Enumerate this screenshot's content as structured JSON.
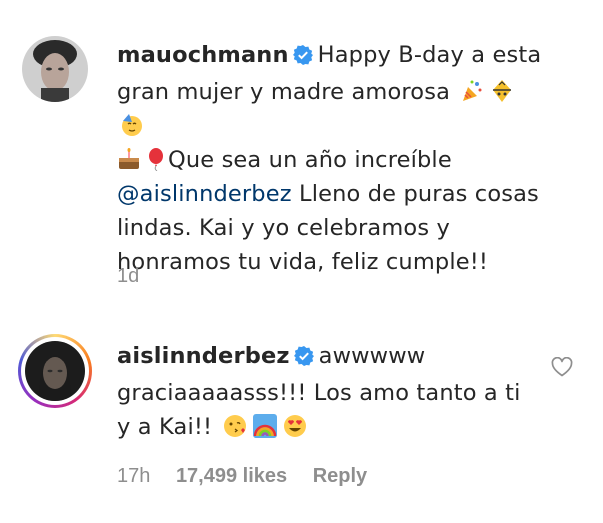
{
  "comments": [
    {
      "username": "mauochmann",
      "segments": {
        "part1": "Happy B-day a esta gran mujer y madre amorosa",
        "part2": "Que sea un año increíble",
        "mention": "@aislinnderbez",
        "part3": "Lleno de puras cosas lindas. Kai y yo celebramos y honramos tu vida, feliz cumple!!"
      },
      "emojis": [
        "party-popper-icon",
        "lantern-face-icon",
        "partying-face-icon",
        "birthday-cake-icon",
        "balloon-icon"
      ],
      "time": "1d"
    },
    {
      "username": "aislinnderbez",
      "text": "awwwww graciaaaaasss!!! Los amo tanto a ti y a Kai!!",
      "emojis": [
        "kissing-face-icon",
        "rainbow-icon",
        "heart-eyes-face-icon"
      ],
      "time": "17h",
      "likes": "17,499 likes",
      "reply": "Reply"
    }
  ],
  "colors": {
    "verified": "#3897f0",
    "mention": "#00376b",
    "meta": "#8e8e8e"
  }
}
